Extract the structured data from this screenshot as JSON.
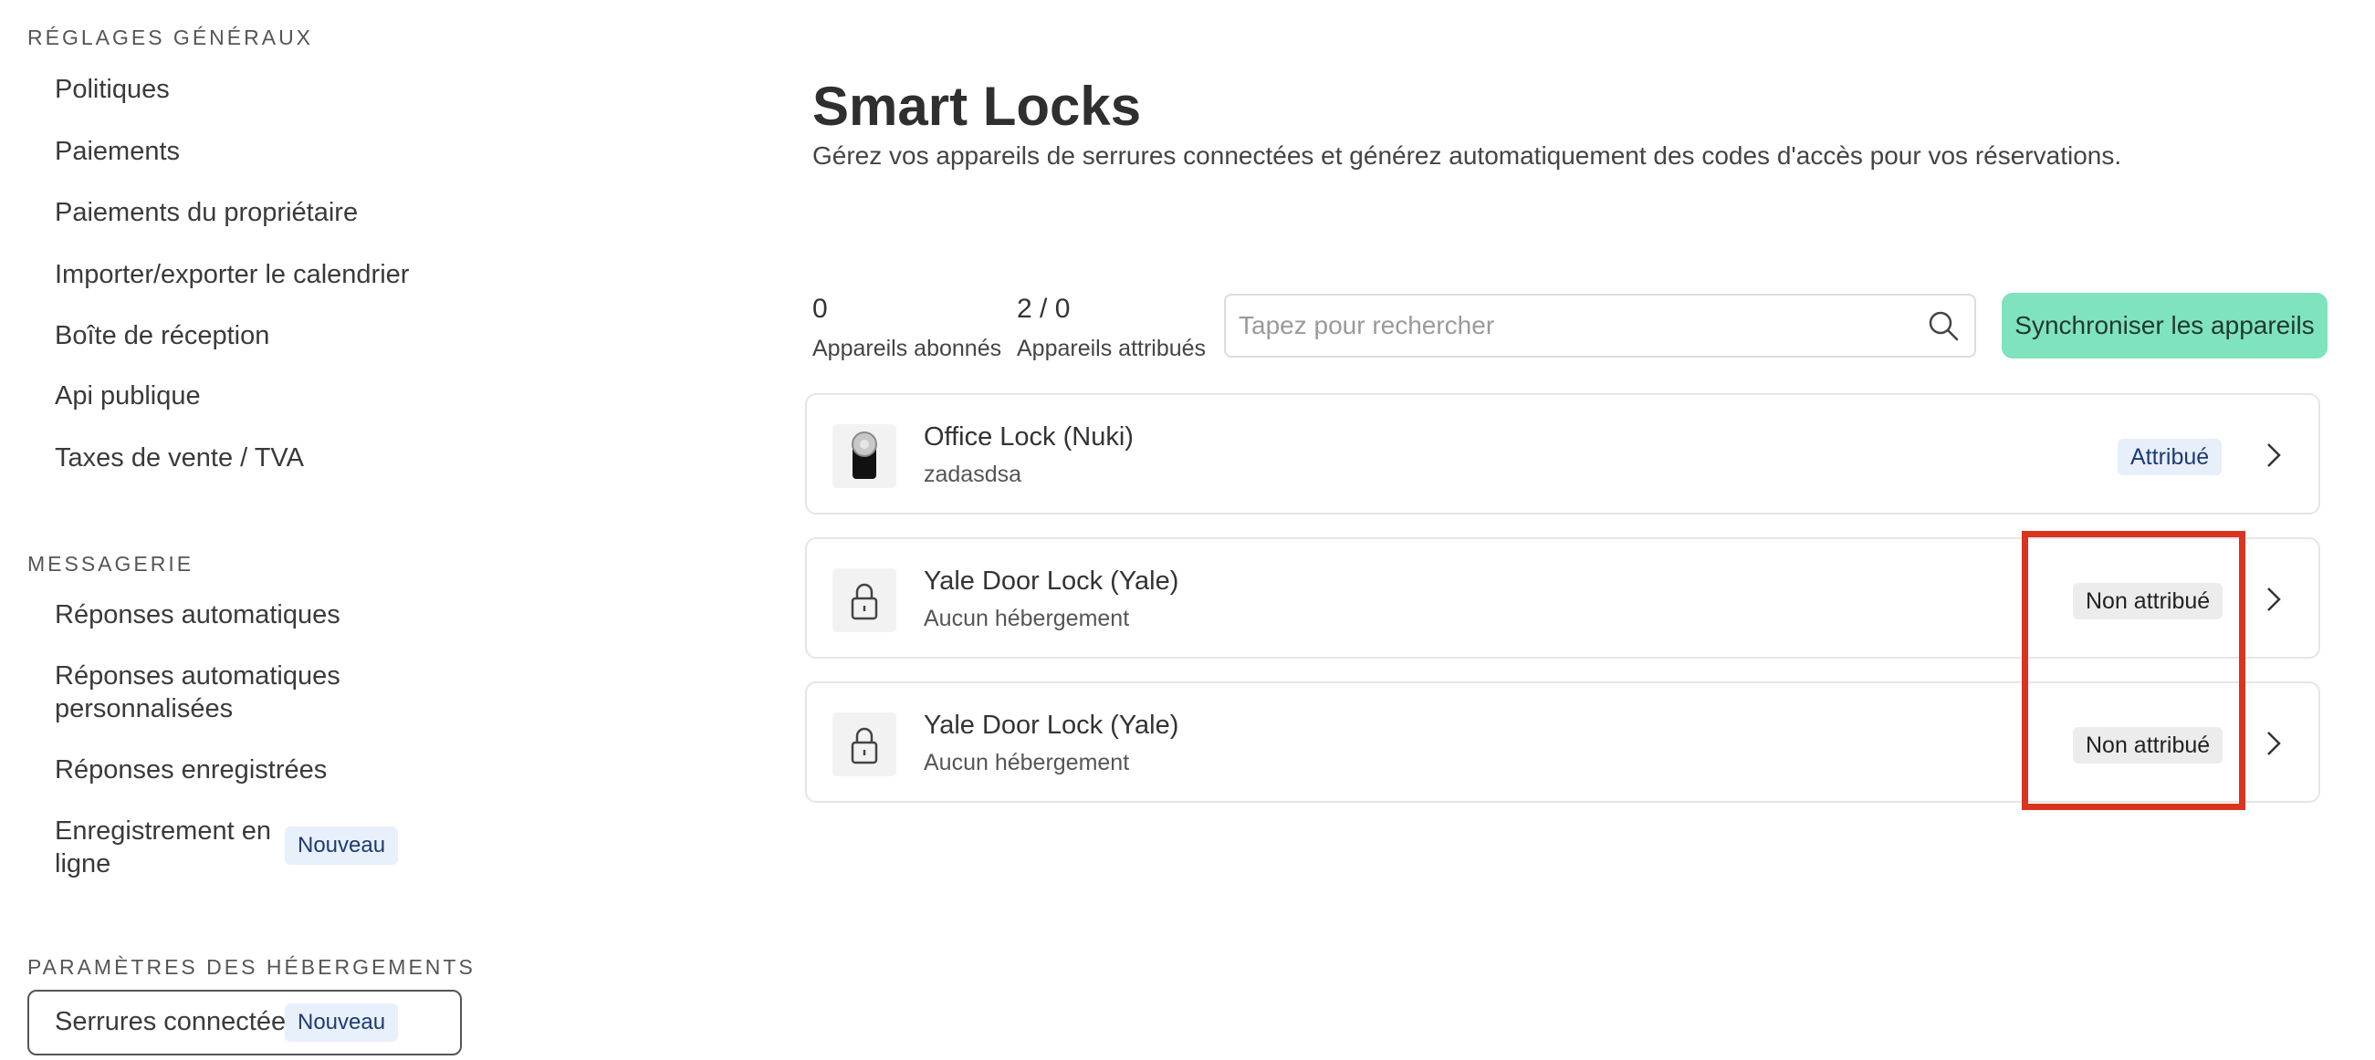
{
  "sidebar": {
    "sections": [
      {
        "title": "RÉGLAGES GÉNÉRAUX",
        "items": [
          {
            "label": "Politiques"
          },
          {
            "label": "Paiements"
          },
          {
            "label": "Paiements du propriétaire"
          },
          {
            "label": "Importer/exporter le calendrier"
          },
          {
            "label": "Boîte de réception"
          },
          {
            "label": "Api publique"
          },
          {
            "label": "Taxes de vente / TVA"
          }
        ]
      },
      {
        "title": "MESSAGERIE",
        "items": [
          {
            "label": "Réponses automatiques"
          },
          {
            "label_line1": "Réponses automatiques",
            "label_line2": "personnalisées"
          },
          {
            "label": "Réponses enregistrées"
          },
          {
            "label_line1": "Enregistrement en",
            "label_line2": "ligne",
            "badge": "Nouveau"
          }
        ]
      },
      {
        "title": "PARAMÈTRES DES HÉBERGEMENTS",
        "items": [
          {
            "label": "Serrures connectées",
            "badge": "Nouveau",
            "active": true
          }
        ]
      }
    ]
  },
  "main": {
    "title": "Smart Locks",
    "subtitle": "Gérez vos appareils de serrures connectées et générez automatiquement des codes d'accès pour vos réservations.",
    "stats": [
      {
        "value": "0",
        "label": "Appareils abonnés"
      },
      {
        "value": "2 / 0",
        "label": "Appareils attribués"
      }
    ],
    "search": {
      "placeholder": "Tapez pour rechercher",
      "value": ""
    },
    "sync_button": "Synchroniser les appareils",
    "devices": [
      {
        "name": "Office Lock (Nuki)",
        "subtitle": "zadasdsa",
        "status": "Attribué",
        "icon": "nuki-device-image"
      },
      {
        "name": "Yale Door Lock (Yale)",
        "subtitle": "Aucun hébergement",
        "status": "Non attribué",
        "icon": "lock-icon"
      },
      {
        "name": "Yale Door Lock (Yale)",
        "subtitle": "Aucun hébergement",
        "status": "Non attribué",
        "icon": "lock-icon"
      }
    ]
  },
  "colors": {
    "accent_button": "#7fe3be",
    "assigned_badge_bg": "#e6effa",
    "unassigned_badge_bg": "#ececec",
    "highlight_box": "#d9341f"
  }
}
